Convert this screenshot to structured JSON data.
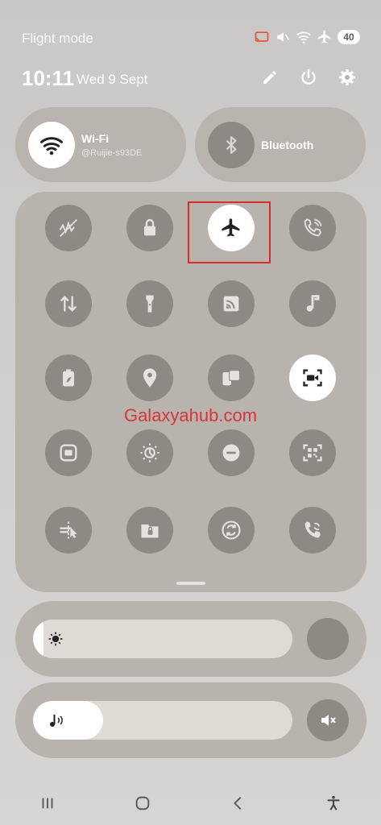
{
  "status": {
    "mode_label": "Flight mode",
    "battery": "40"
  },
  "header": {
    "time": "10:11",
    "date": "Wed 9 Sept"
  },
  "tiles_large": {
    "wifi": {
      "title": "Wi-Fi",
      "subtitle": "@Ruijie-s93DE",
      "state": "on"
    },
    "bluetooth": {
      "title": "Bluetooth",
      "state": "off"
    }
  },
  "quick_tiles": [
    {
      "name": "mobile-data-icon",
      "state": "off"
    },
    {
      "name": "lock-icon",
      "state": "off"
    },
    {
      "name": "airplane-icon",
      "state": "on"
    },
    {
      "name": "wifi-calling-icon",
      "state": "off"
    },
    {
      "name": "data-transfer-icon",
      "state": "off"
    },
    {
      "name": "flashlight-icon",
      "state": "off"
    },
    {
      "name": "cast-icon",
      "state": "off"
    },
    {
      "name": "music-note-icon",
      "state": "off"
    },
    {
      "name": "power-saving-icon",
      "state": "off"
    },
    {
      "name": "location-icon",
      "state": "off"
    },
    {
      "name": "link-to-windows-icon",
      "state": "off"
    },
    {
      "name": "screen-recorder-icon",
      "state": "on"
    },
    {
      "name": "screenshot-icon",
      "state": "off"
    },
    {
      "name": "eye-comfort-icon",
      "state": "off"
    },
    {
      "name": "do-not-disturb-icon",
      "state": "off"
    },
    {
      "name": "qr-scanner-icon",
      "state": "off"
    },
    {
      "name": "nearby-share-icon",
      "state": "off"
    },
    {
      "name": "secure-folder-icon",
      "state": "off"
    },
    {
      "name": "sync-icon",
      "state": "off"
    },
    {
      "name": "call-sync-icon",
      "state": "off"
    }
  ],
  "watermark": "Galaxyahub.com",
  "brightness": {
    "level": 0.04
  },
  "volume": {
    "level": 0.27
  },
  "colors": {
    "panel": "#b8b3ac",
    "tile_off": "#8d8983",
    "highlight": "#d92c2c",
    "watermark": "#d8353a"
  }
}
